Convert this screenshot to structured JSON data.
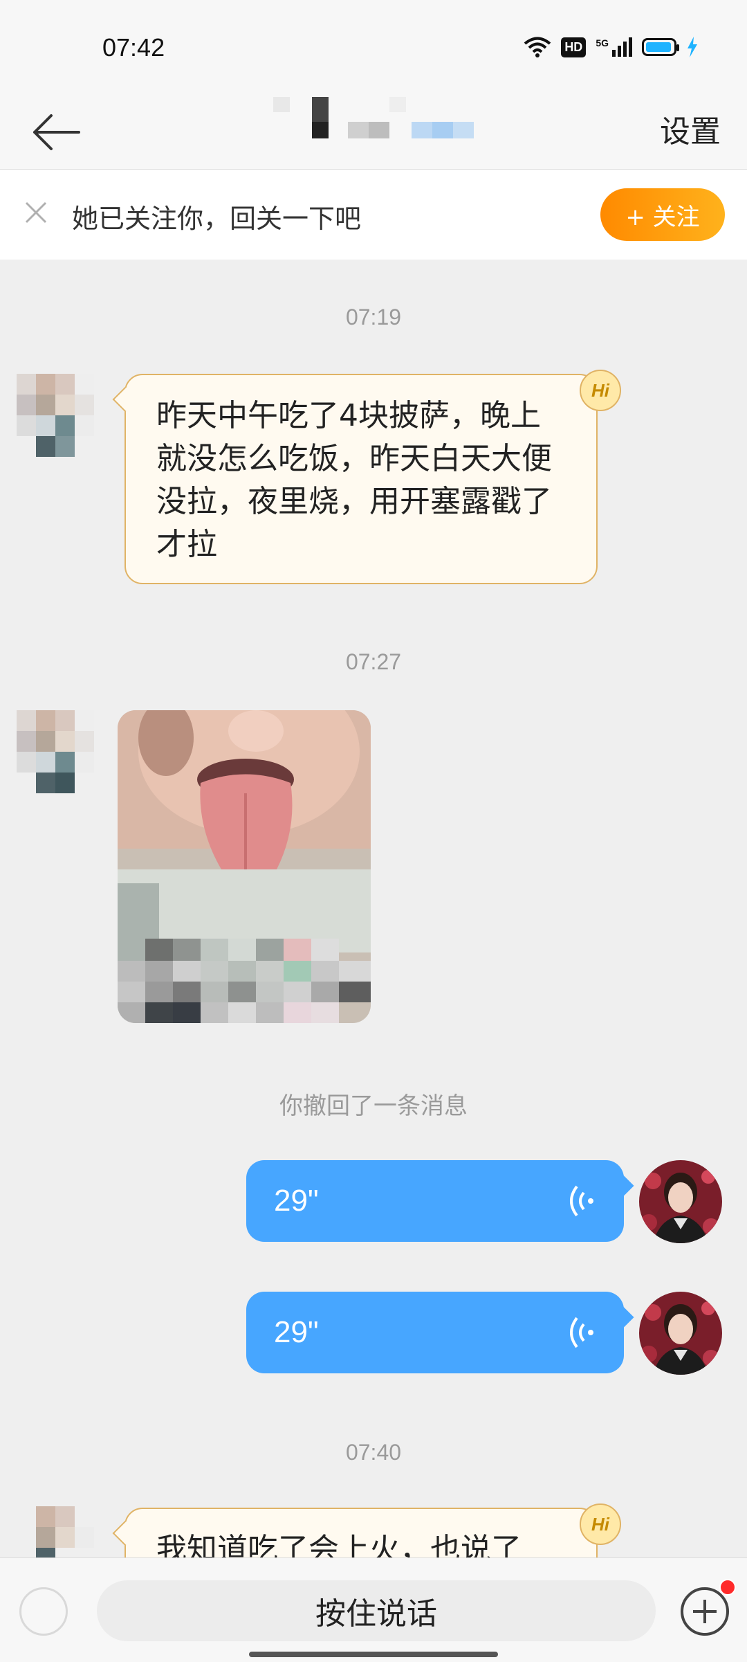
{
  "status_bar": {
    "time": "07:42",
    "hd": "HD",
    "network": "5G",
    "battery_level": 0.9,
    "battery_color": "#1fb3ff"
  },
  "nav": {
    "back_icon": "arrow-left-icon",
    "settings_label": "设置"
  },
  "follow_banner": {
    "text": "她已关注你，回关一下吧",
    "follow_button": "+ 关注",
    "accent": "#ff9a0a"
  },
  "chat": {
    "timestamps": [
      "07:19",
      "07:27",
      "07:40"
    ],
    "messages": [
      {
        "from": "other",
        "type": "text",
        "text": "昨天中午吃了4块披萨，晚上就没怎么吃饭，昨天白天大便没拉，夜里烧，用开塞露戳了才拉",
        "badge": "Hi"
      },
      {
        "from": "other",
        "type": "image"
      },
      {
        "type": "system",
        "text": "你撤回了一条消息"
      },
      {
        "from": "me",
        "type": "voice",
        "duration": "29\""
      },
      {
        "from": "me",
        "type": "voice",
        "duration": "29\""
      },
      {
        "from": "other",
        "type": "text",
        "text": "我知道吃了会上火，也说了",
        "badge": "Hi"
      }
    ],
    "incoming_bubble_color": "#fffaf0",
    "outgoing_bubble_color": "#47a6ff"
  },
  "input_bar": {
    "hold_to_talk": "按住说话",
    "plus_icon": "plus-circle-icon"
  }
}
